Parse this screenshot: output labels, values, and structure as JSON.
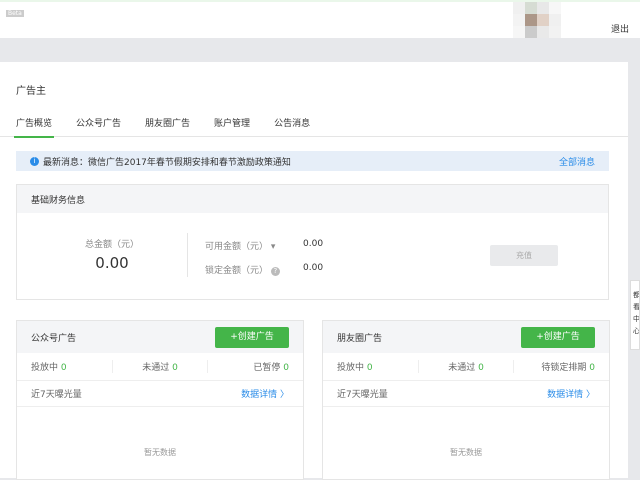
{
  "header": {
    "beta": "Beta",
    "logout": "退出"
  },
  "title": "广告主",
  "tabs": [
    "广告概览",
    "公众号广告",
    "朋友圈广告",
    "账户管理",
    "公告消息"
  ],
  "notice": {
    "text": "最新消息：微信广告2017年春节假期安排和春节激励政策通知",
    "all": "全部消息"
  },
  "finance": {
    "title": "基础财务信息",
    "total_label": "总金额（元）",
    "total_value": "0.00",
    "available_label": "可用金额（元）",
    "available_value": "0.00",
    "locked_label": "锁定金额（元）",
    "locked_value": "0.00",
    "recharge": "充值"
  },
  "official": {
    "title": "公众号广告",
    "create": "+创建广告",
    "stats": [
      {
        "label": "投放中",
        "value": "0"
      },
      {
        "label": "未通过",
        "value": "0"
      },
      {
        "label": "已暂停",
        "value": "0"
      }
    ],
    "exposure": "近7天曝光量",
    "detail": "数据详情",
    "empty": "暂无数据"
  },
  "moments": {
    "title": "朋友圈广告",
    "create": "+创建广告",
    "stats": [
      {
        "label": "投放中",
        "value": "0"
      },
      {
        "label": "未通过",
        "value": "0"
      },
      {
        "label": "待锁定排期",
        "value": "0"
      }
    ],
    "exposure": "近7天曝光量",
    "detail": "数据详情",
    "empty": "暂无数据"
  },
  "side_popup": [
    "都",
    "看",
    "中",
    "心"
  ],
  "colors": {
    "accent": "#44b549",
    "link": "#2a8ce8"
  }
}
